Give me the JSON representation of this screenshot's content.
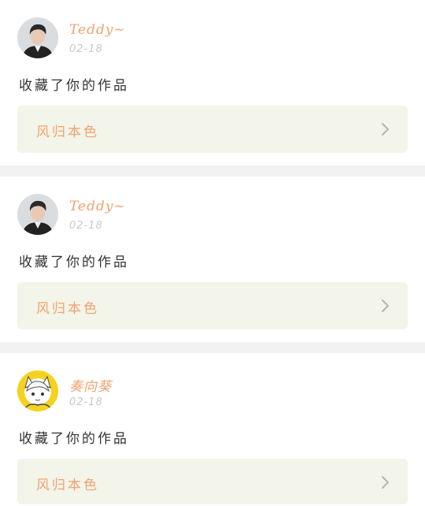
{
  "feed": {
    "items": [
      {
        "username": "Teddy~",
        "date": "02-18",
        "action": "收藏了你的作品",
        "work_title": "风归本色",
        "avatar_icon": "avatar-photo-man"
      },
      {
        "username": "Teddy~",
        "date": "02-18",
        "action": "收藏了你的作品",
        "work_title": "风归本色",
        "avatar_icon": "avatar-photo-man"
      },
      {
        "username": "奏向葵",
        "date": "02-18",
        "action": "收藏了你的作品",
        "work_title": "风归本色",
        "avatar_icon": "avatar-anime-character"
      }
    ]
  },
  "colors": {
    "accent": "#f0a36d",
    "link_background": "#f3f4ea",
    "separator": "#f2f2f2",
    "date_text": "#c8c8c8"
  }
}
